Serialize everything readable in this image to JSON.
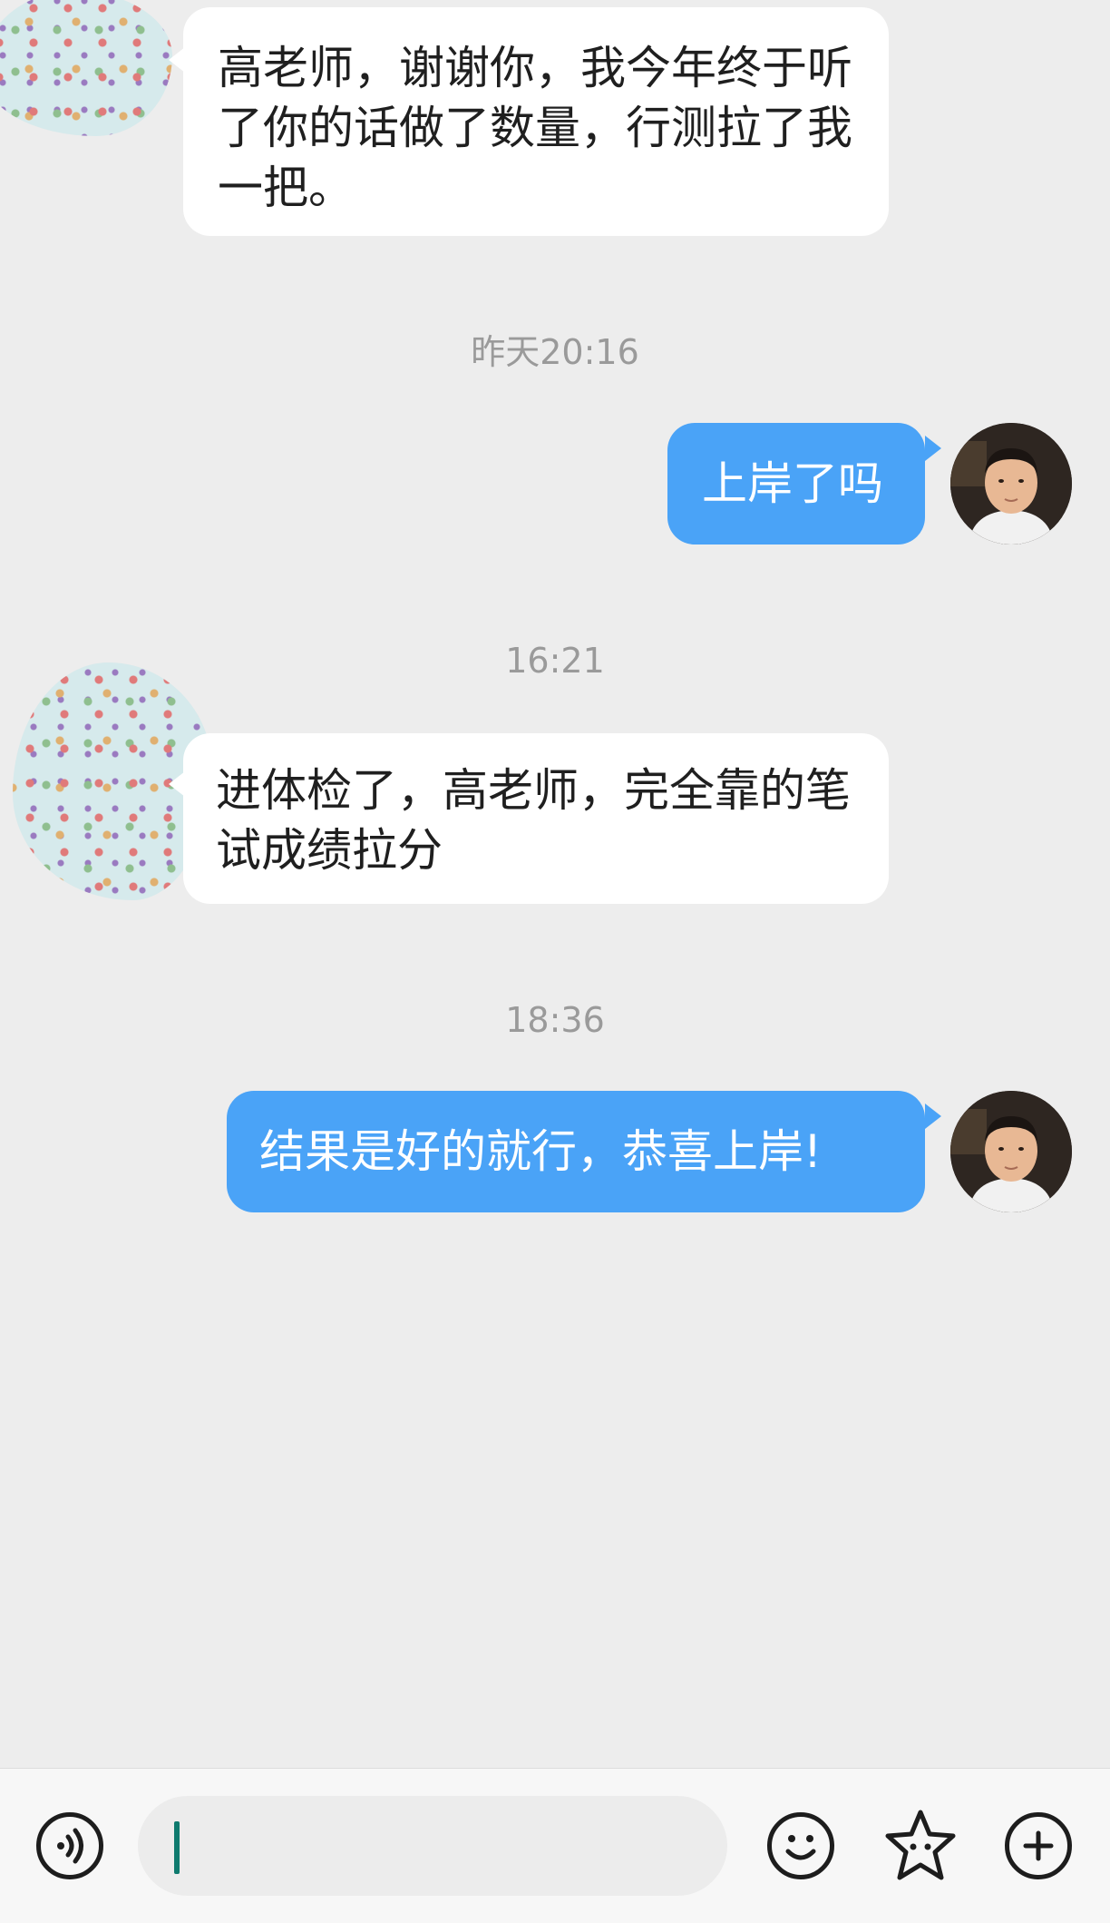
{
  "messages": [
    {
      "side": "in",
      "text": "高老师，谢谢你，我今年终于听了你的话做了数量，行测拉了我一把。"
    },
    {
      "timestamp": "昨天20:16"
    },
    {
      "side": "out",
      "text": "上岸了吗"
    },
    {
      "timestamp": "16:21"
    },
    {
      "side": "in",
      "text": "进体检了，高老师，完全靠的笔试成绩拉分"
    },
    {
      "timestamp": "18:36"
    },
    {
      "side": "out",
      "text": "结果是好的就行，恭喜上岸!"
    }
  ],
  "input_bar": {
    "input_value": "",
    "icons": [
      "voice-icon",
      "emoji-icon",
      "sticker-icon",
      "plus-icon"
    ]
  },
  "colors": {
    "background": "#ededed",
    "outgoing_bubble": "#4aa3f7",
    "incoming_bubble": "#ffffff",
    "timestamp_text": "#9a9a9a",
    "caret": "#0e7a6e"
  }
}
